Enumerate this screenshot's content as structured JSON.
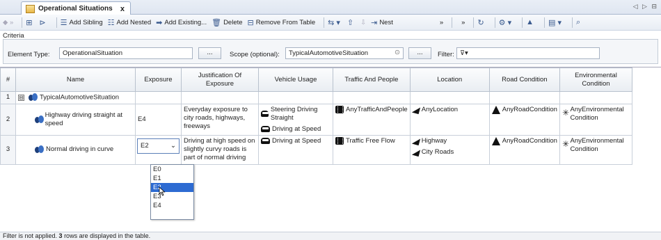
{
  "tab": {
    "title": "Operational Situations",
    "close": "x",
    "nav": "◁ ▷ ⊟"
  },
  "toolbar": {
    "add_sibling": "Add Sibling",
    "add_nested": "Add Nested",
    "add_existing": "Add Existing...",
    "delete": "Delete",
    "remove_from_table": "Remove From Table",
    "nest": "Nest"
  },
  "criteria": {
    "label": "Criteria",
    "element_type_label": "Element Type:",
    "element_type_value": "OperationalSituation",
    "browse": "...",
    "scope_label": "Scope (optional):",
    "scope_value": "TypicalAutomotiveSituation",
    "filter_label": "Filter:"
  },
  "table": {
    "columns": [
      "#",
      "Name",
      "Exposure",
      "Justification Of Exposure",
      "Vehicle Usage",
      "Traffic And People",
      "Location",
      "Road Condition",
      "Environmental Condition"
    ],
    "group_row": {
      "num": "1",
      "expander": "⊟",
      "name": "TypicalAutomotiveSituation"
    },
    "rows": [
      {
        "num": "2",
        "name": "Highway driving straight at speed",
        "exposure": "E4",
        "justification": "Everyday exposure to city roads, highways, freeways",
        "vehicle_usage": [
          "Steering Driving Straight",
          "Driving at Speed"
        ],
        "traffic": "AnyTrafficAndPeople",
        "location": [
          "AnyLocation"
        ],
        "road": "AnyRoadCondition",
        "env": "AnyEnvironmental Condition"
      },
      {
        "num": "3",
        "name": "Normal driving in curve",
        "exposure": "E2",
        "justification": "Driving at high speed on slightly curvy roads is part of normal driving",
        "vehicle_usage": [
          "Driving at Speed"
        ],
        "traffic": "Traffic Free Flow",
        "location": [
          "Highway",
          "City Roads"
        ],
        "road": "AnyRoadCondition",
        "env": "AnyEnvironmental Condition"
      }
    ]
  },
  "dropdown": {
    "options": [
      "E0",
      "E1",
      "E2",
      "E3",
      "E4"
    ],
    "selected": "E2"
  },
  "status": {
    "prefix": "Filter is not applied. ",
    "count": "3",
    "suffix": " rows are displayed in the table."
  }
}
